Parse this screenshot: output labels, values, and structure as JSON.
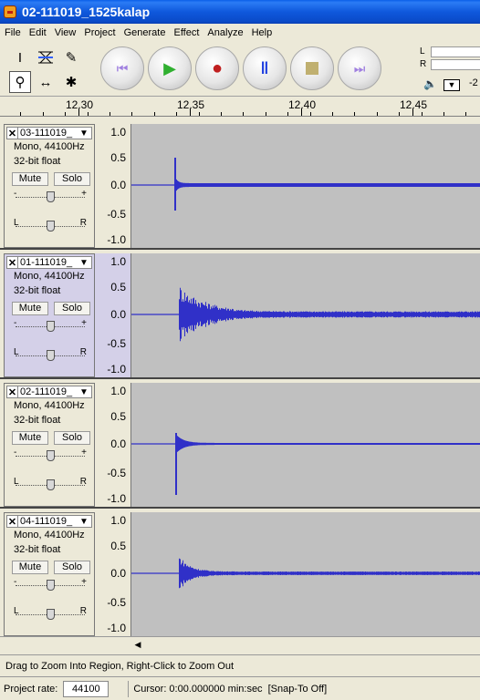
{
  "window": {
    "title": "02-111019_1525kalap"
  },
  "menu": [
    "File",
    "Edit",
    "View",
    "Project",
    "Generate",
    "Effect",
    "Analyze",
    "Help"
  ],
  "tools": [
    "selection-tool",
    "envelope-tool",
    "draw-tool",
    "zoom-tool",
    "timeshift-tool",
    "multi-tool"
  ],
  "transport": [
    "skip-start",
    "play",
    "record",
    "pause",
    "stop",
    "skip-end"
  ],
  "meter": {
    "left": "L",
    "right": "R",
    "value": "-2"
  },
  "ruler": {
    "labels": [
      "12.30",
      "12.35",
      "12.40",
      "12.45"
    ]
  },
  "scale_labels": [
    "1.0",
    "0.5",
    "0.0",
    "-0.5",
    "-1.0"
  ],
  "tracks": [
    {
      "name": "03-111019_",
      "info1": "Mono, 44100Hz",
      "info2": "32-bit float",
      "mute": "Mute",
      "solo": "Solo",
      "gain_minus": "-",
      "gain_plus": "+",
      "pan_left": "L",
      "pan_right": "R",
      "selected": false,
      "style": "spike"
    },
    {
      "name": "01-111019_",
      "info1": "Mono, 44100Hz",
      "info2": "32-bit float",
      "mute": "Mute",
      "solo": "Solo",
      "gain_minus": "-",
      "gain_plus": "+",
      "pan_left": "L",
      "pan_right": "R",
      "selected": true,
      "style": "burst"
    },
    {
      "name": "02-111019_",
      "info1": "Mono, 44100Hz",
      "info2": "32-bit float",
      "mute": "Mute",
      "solo": "Solo",
      "gain_minus": "-",
      "gain_plus": "+",
      "pan_left": "L",
      "pan_right": "R",
      "selected": false,
      "style": "decay"
    },
    {
      "name": "04-111019_",
      "info1": "Mono, 44100Hz",
      "info2": "32-bit float",
      "mute": "Mute",
      "solo": "Solo",
      "gain_minus": "-",
      "gain_plus": "+",
      "pan_left": "L",
      "pan_right": "R",
      "selected": false,
      "style": "small-burst"
    }
  ],
  "status": {
    "message": "Drag to Zoom Into Region, Right-Click to Zoom Out"
  },
  "bottom": {
    "rate_label": "Project rate:",
    "rate_value": "44100",
    "cursor": "Cursor: 0:00.000000 min:sec",
    "snap": "[Snap-To Off]"
  },
  "colors": {
    "wave": "#3030c8",
    "wave_bg": "#c0c0c0",
    "titlebar": "#0a58dc"
  }
}
